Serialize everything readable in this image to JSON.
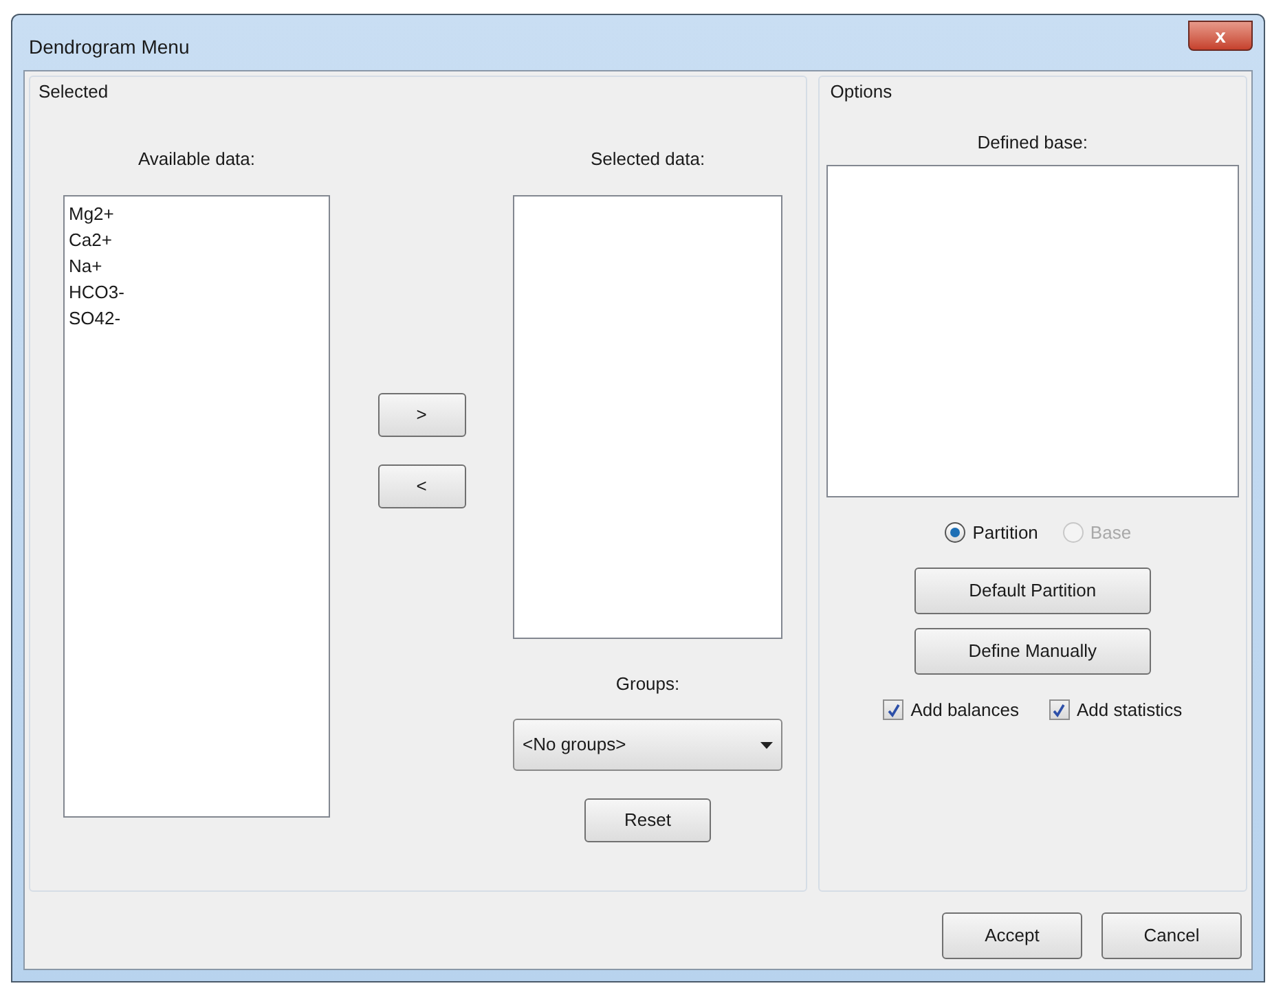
{
  "window": {
    "title": "Dendrogram Menu",
    "close_label": "x"
  },
  "selected_group": {
    "title": "Selected",
    "available": {
      "label": "Available data:",
      "items": [
        "Mg2+",
        "Ca2+",
        "Na+",
        "HCO3-",
        "SO42-"
      ]
    },
    "move_buttons": [
      ">",
      "<"
    ],
    "selected": {
      "label": "Selected data:"
    },
    "groups": {
      "label": "Groups:",
      "value": "<No groups>"
    },
    "reset_button": "Reset"
  },
  "options_group": {
    "title": "Options",
    "defined_base_label": "Defined base:",
    "radios": [
      {
        "label": "Partition",
        "selected": true,
        "disabled": false
      },
      {
        "label": "Base",
        "selected": false,
        "disabled": true
      }
    ],
    "buttons": [
      "Default Partition",
      "Define Manually"
    ],
    "checkboxes": [
      {
        "label": "Add balances",
        "checked": true
      },
      {
        "label": "Add statistics",
        "checked": true
      }
    ]
  },
  "footer_buttons": [
    "Accept",
    "Cancel"
  ]
}
